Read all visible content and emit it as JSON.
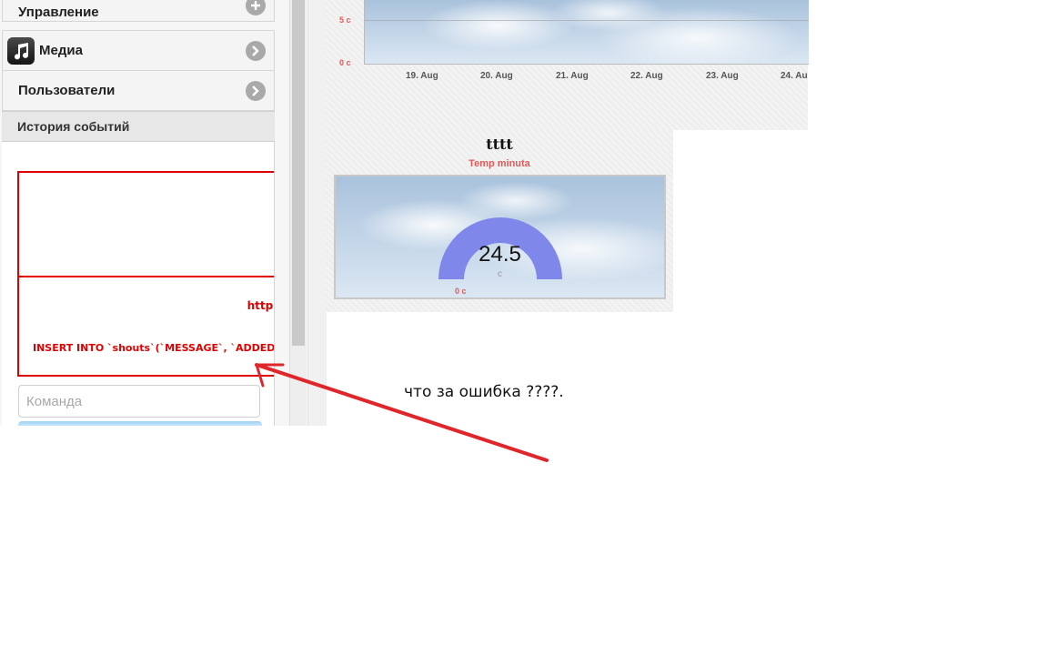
{
  "sidebar": {
    "manage_label": "Управление",
    "media_label": "Медиа",
    "users_label": "Пользователи",
    "history_title": "История событий",
    "error_url": "http:",
    "error_sql": "INSERT INTO `shouts`(`MESSAGE`, `ADDED",
    "command_placeholder": "Команда"
  },
  "chart": {
    "x_ticks": [
      "19. Aug",
      "20. Aug",
      "21. Aug",
      "22. Aug",
      "23. Aug",
      "24. Au"
    ],
    "y_ticks": [
      "5 c",
      "0 c"
    ]
  },
  "gauge": {
    "title": "tttt",
    "subtitle": "Temp minuta",
    "value": "24.5",
    "unit": "c",
    "min_label": "0 c",
    "fill_fraction": 0.49,
    "fill_color": "#8087ea"
  },
  "annotation": {
    "text": "что за ошибка  ????.",
    "arrow_color": "#e0262b"
  },
  "colors": {
    "error": "#e00000",
    "axis_label": "#e05a5a"
  },
  "icons": {
    "media": "music-note-icon",
    "nav": "chevron-right-icon",
    "add": "plus-icon"
  }
}
